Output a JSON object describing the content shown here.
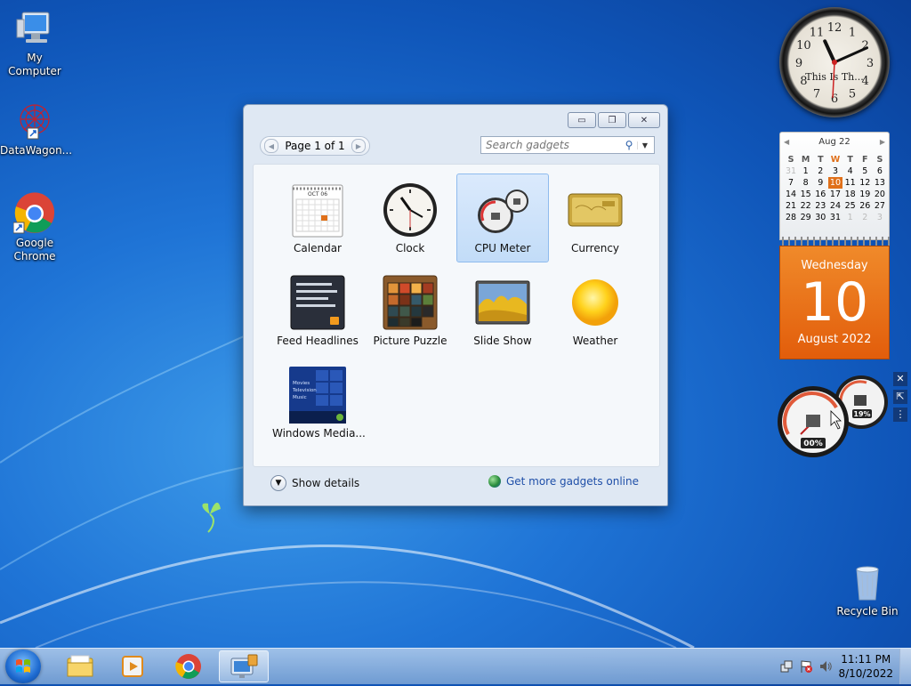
{
  "desktop": {
    "icons": [
      {
        "label": "My Computer",
        "icon": "computer-icon"
      },
      {
        "label": "DataWagon...",
        "icon": "datawagon-shortcut-icon"
      },
      {
        "label": "Google Chrome",
        "icon": "chrome-shortcut-icon"
      },
      {
        "label": "Recycle Bin",
        "icon": "recycle-bin-icon"
      }
    ]
  },
  "gallery": {
    "page_label": "Page 1 of 1",
    "search_placeholder": "Search gadgets",
    "gadgets": [
      {
        "label": "Calendar",
        "icon": "calendar-gadget-icon",
        "selected": false
      },
      {
        "label": "Clock",
        "icon": "clock-gadget-icon",
        "selected": false
      },
      {
        "label": "CPU Meter",
        "icon": "cpu-meter-gadget-icon",
        "selected": true
      },
      {
        "label": "Currency",
        "icon": "currency-gadget-icon",
        "selected": false
      },
      {
        "label": "Feed Headlines",
        "icon": "feed-headlines-gadget-icon",
        "selected": false
      },
      {
        "label": "Picture Puzzle",
        "icon": "picture-puzzle-gadget-icon",
        "selected": false
      },
      {
        "label": "Slide Show",
        "icon": "slide-show-gadget-icon",
        "selected": false
      },
      {
        "label": "Weather",
        "icon": "weather-gadget-icon",
        "selected": false
      },
      {
        "label": "Windows Media...",
        "icon": "windows-media-center-gadget-icon",
        "selected": false
      }
    ],
    "calendar_thumb_month": "OCT 06",
    "media_thumb_lines": [
      "Movies",
      "Television",
      "Music"
    ],
    "show_details_label": "Show details",
    "get_more_label": "Get more gadgets online"
  },
  "clock_gadget": {
    "caption": "This Is Th...",
    "numerals": [
      "12",
      "1",
      "2",
      "3",
      "4",
      "5",
      "6",
      "7",
      "8",
      "9",
      "10",
      "11"
    ],
    "hour": 11,
    "minute": 11
  },
  "calendar_gadget": {
    "month_label": "Aug 22",
    "weekday_headers": [
      "S",
      "M",
      "T",
      "W",
      "T",
      "F",
      "S"
    ],
    "weeks": [
      [
        "31",
        "1",
        "2",
        "3",
        "4",
        "5",
        "6"
      ],
      [
        "7",
        "8",
        "9",
        "10",
        "11",
        "12",
        "13"
      ],
      [
        "14",
        "15",
        "16",
        "17",
        "18",
        "19",
        "20"
      ],
      [
        "21",
        "22",
        "23",
        "24",
        "25",
        "26",
        "27"
      ],
      [
        "28",
        "29",
        "30",
        "31",
        "1",
        "2",
        "3"
      ]
    ],
    "today": "10",
    "weekday": "Wednesday",
    "day": "10",
    "month_year": "August 2022"
  },
  "cpu_gadget": {
    "cpu_percent": "00%",
    "memory_percent": "19%"
  },
  "taskbar": {
    "time": "11:11 PM",
    "date": "8/10/2022",
    "items": [
      "file-explorer-icon",
      "media-player-icon",
      "chrome-icon",
      "gadgets-icon"
    ]
  },
  "colors": {
    "desktop_blue": "#1f74d6",
    "calendar_orange": "#e25d0b",
    "selection_blue": "#c2dcf8"
  }
}
